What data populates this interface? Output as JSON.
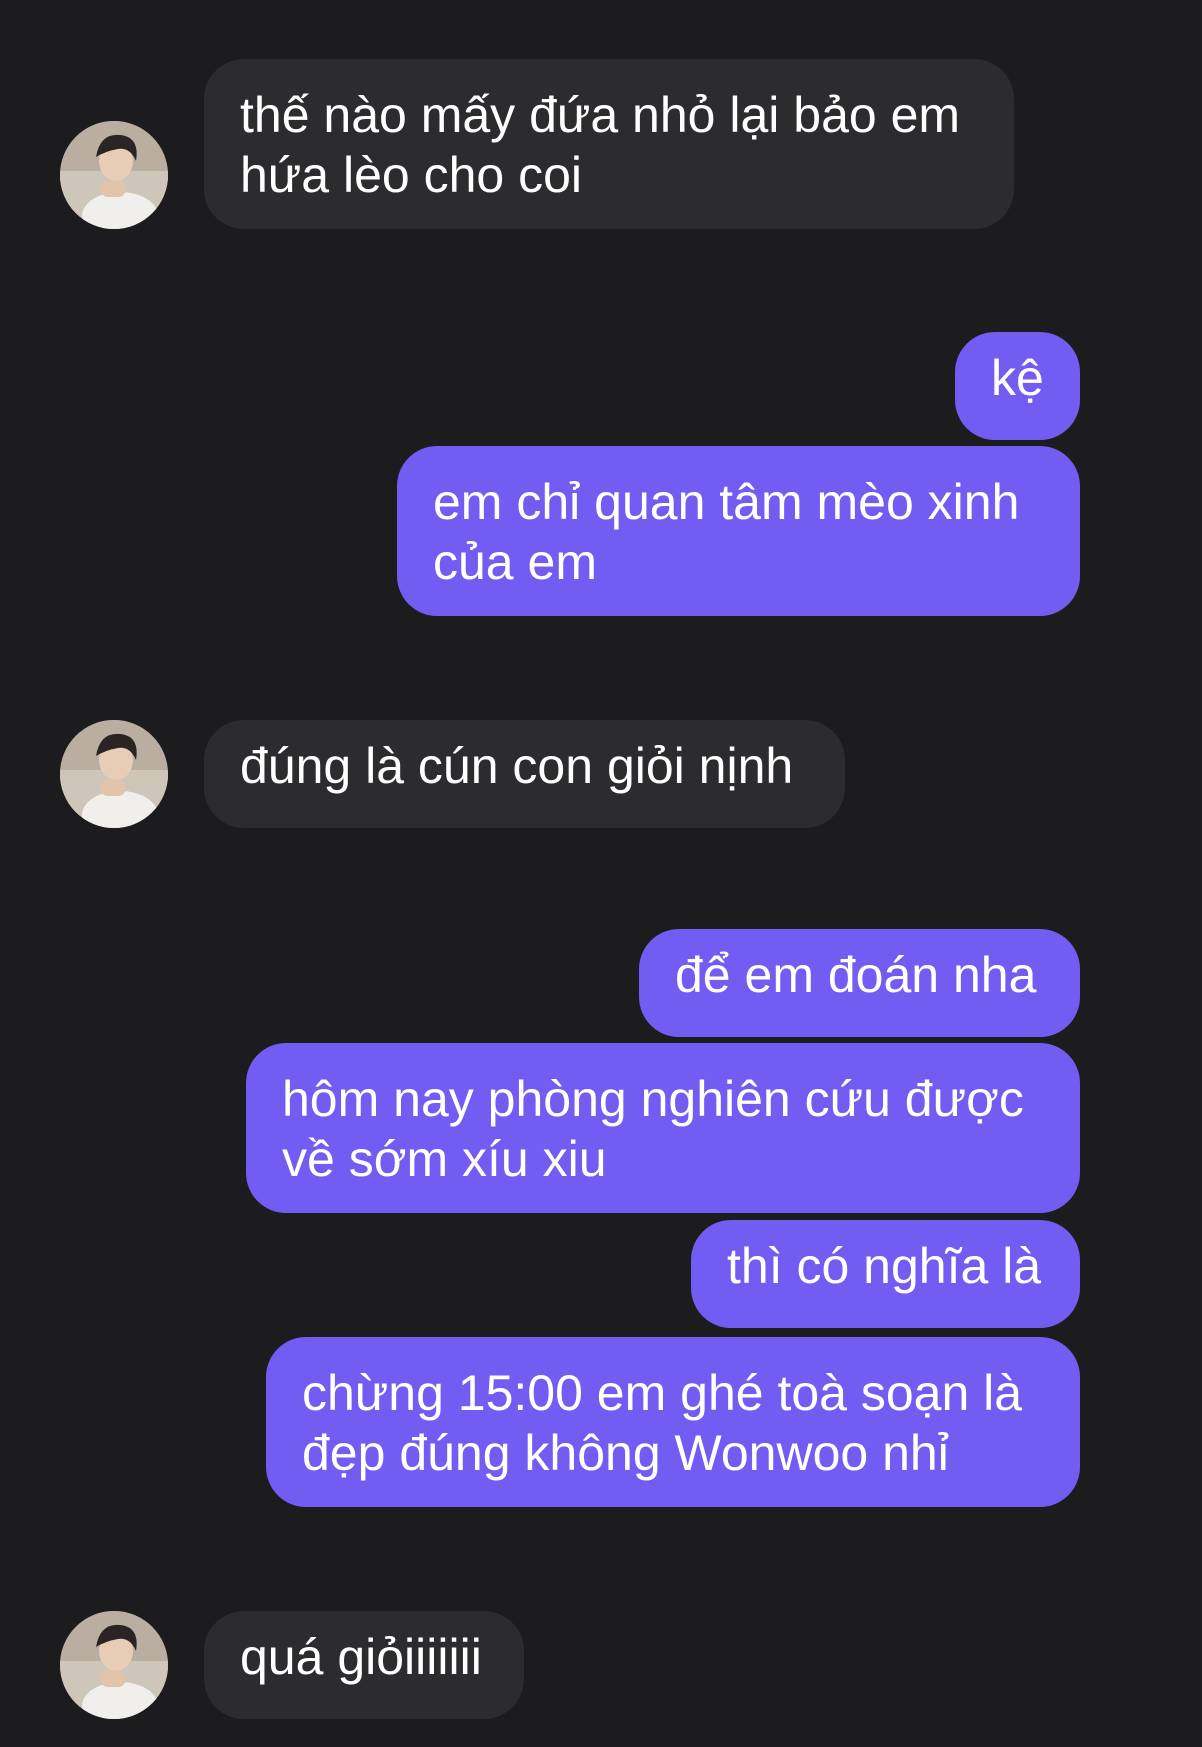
{
  "colors": {
    "background": "#1c1c1e",
    "incoming_bubble": "#2c2c2e",
    "outgoing_bubble": "#735cf2",
    "text": "#ffffff"
  },
  "avatar_icon": "person-photo-avatar",
  "messages": [
    {
      "from": "other",
      "text": "thế nào mấy đứa nhỏ lại bảo em hứa lèo cho coi"
    },
    {
      "from": "me",
      "text": "kệ"
    },
    {
      "from": "me",
      "text": "em chỉ quan tâm mèo xinh của em"
    },
    {
      "from": "other",
      "text": "đúng là cún con giỏi nịnh"
    },
    {
      "from": "me",
      "text": "để em đoán nha"
    },
    {
      "from": "me",
      "text": "hôm nay phòng nghiên cứu được về sớm xíu xiu"
    },
    {
      "from": "me",
      "text": "thì có nghĩa là"
    },
    {
      "from": "me",
      "text": "chừng 15:00 em ghé toà soạn là đẹp đúng không Wonwoo nhỉ"
    },
    {
      "from": "other",
      "text": "quá giỏiiiiiii"
    }
  ]
}
